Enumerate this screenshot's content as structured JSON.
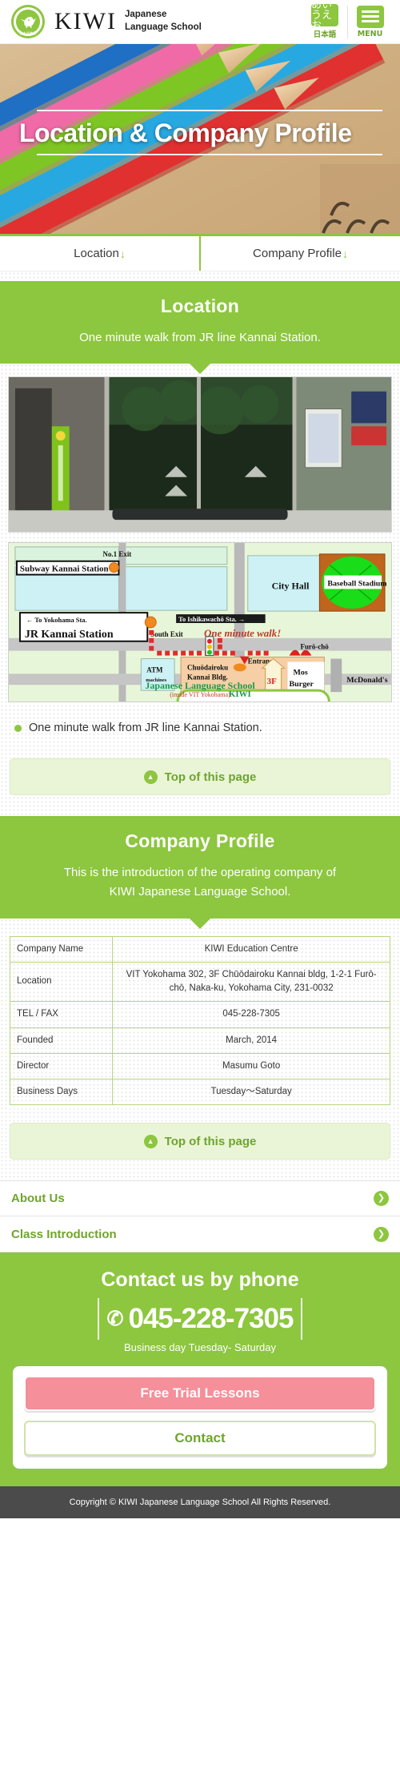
{
  "header": {
    "brand": "KIWI",
    "brand_sub_line1": "Japanese",
    "brand_sub_line2": "Language School",
    "logo_badge_text": "日本語教室",
    "lang_glyph": "あいうえお",
    "lang_label": "日本語",
    "menu_label": "MENU"
  },
  "hero": {
    "title": "Location & Company Profile"
  },
  "tabnav": {
    "items": [
      {
        "label": "Location",
        "arrow": "↓"
      },
      {
        "label": "Company Profile",
        "arrow": "↓"
      }
    ]
  },
  "location": {
    "heading": "Location",
    "subheading": "One minute walk from JR line Kannai Station.",
    "bullet": "One minute walk from JR line Kannai Station.",
    "top_of_page": "Top of this page"
  },
  "map": {
    "subway_station": "Subway  Kannai Station",
    "exit_no1": "No.1  Exit",
    "city_hall": "City Hall",
    "baseball_stadium": "Baseball Stadium",
    "to_yokohama": "← To Yokohama Sta.",
    "jr_station": "JR Kannai Station",
    "south_exit": "South Exit",
    "to_ishikawacho": "To Ishikawachō Sta. →",
    "one_minute_walk": "One minute walk!",
    "furo_cho": "Furō-chō",
    "atm": "ATM",
    "atm_sub": "machines",
    "building_line1": "Chuōdairoku",
    "building_line2": "Kannai Bldg.",
    "entrance": "Entrance",
    "floor": "3F",
    "mos": "Mos",
    "burger": "Burger",
    "mcdonalds": "McDonald's",
    "kiwi_line1": "KIWI",
    "kiwi_line2": "Japanese Language School",
    "kiwi_line3": "(inside VIT Yokohama)"
  },
  "company": {
    "heading": "Company Profile",
    "subheading_line1": "This is the introduction of the operating company of",
    "subheading_line2": "KIWI Japanese Language School.",
    "top_of_page": "Top of this page",
    "rows": [
      {
        "label": "Company Name",
        "value": "KIWI Education Centre"
      },
      {
        "label": "Location",
        "value": "VIT Yokohama 302, 3F Chūōdairoku Kannai bldg, 1-2-1 Furō-chō, Naka-ku, Yokohama City, 231-0032"
      },
      {
        "label": "TEL / FAX",
        "value": "045-228-7305"
      },
      {
        "label": "Founded",
        "value": "March, 2014"
      },
      {
        "label": "Director",
        "value": "Masumu Goto"
      },
      {
        "label": "Business Days",
        "value": "Tuesday〜Saturday"
      }
    ]
  },
  "links": [
    {
      "label": "About Us"
    },
    {
      "label": "Class Introduction"
    }
  ],
  "contact": {
    "heading": "Contact us by phone",
    "phone": "045-228-7305",
    "phone_glyph": "✆",
    "business_day": "Business day  Tuesday- Saturday",
    "cta_primary": "Free Trial Lessons",
    "cta_secondary": "Contact"
  },
  "footer": {
    "copyright": "Copyright © KIWI Japanese Language School All Rights Reserved."
  },
  "colors": {
    "brand_green": "#8dc63f",
    "light_green": "#eaf5d8",
    "pink": "#f58f9a",
    "footer_gray": "#4b4b4b"
  }
}
